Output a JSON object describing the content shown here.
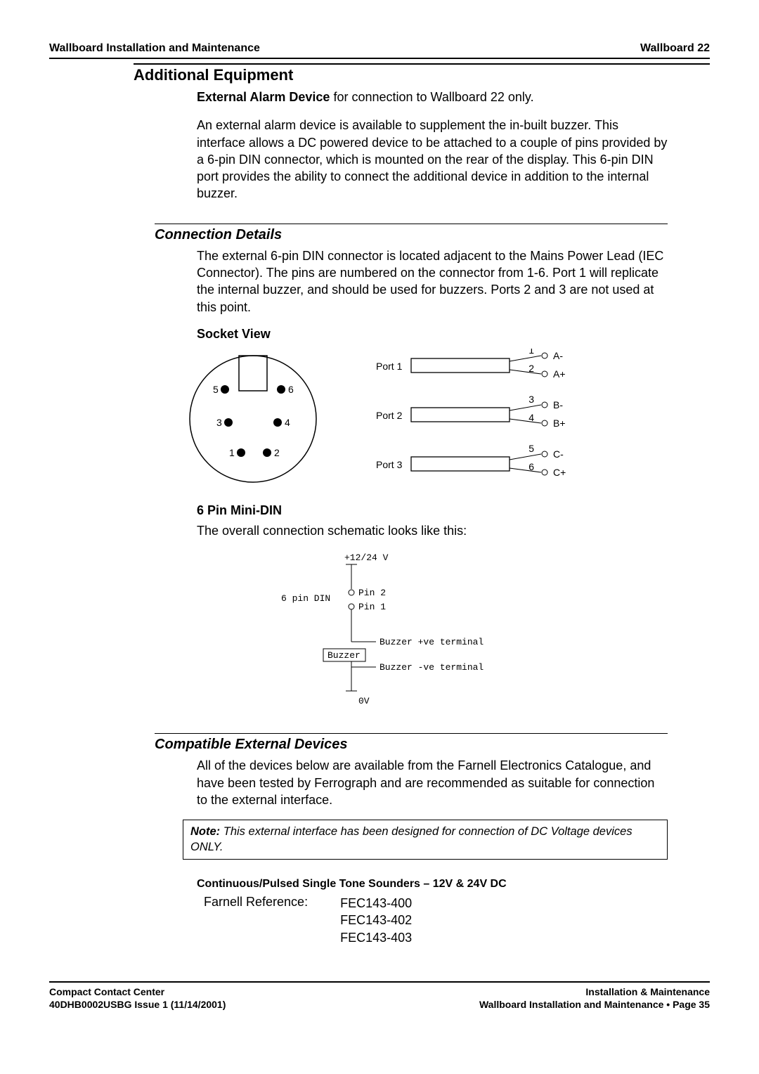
{
  "header": {
    "left": "Wallboard Installation and Maintenance",
    "right": "Wallboard 22"
  },
  "section1": {
    "heading": "Additional Equipment",
    "p1a": "External Alarm Device",
    "p1b": " for connection to Wallboard 22 only.",
    "p2": "An external alarm device is available to supplement the in-built buzzer. This interface allows a DC powered device to be attached to a couple of pins provided by a 6-pin DIN connector, which is mounted on the rear of the display.  This 6-pin DIN port provides the ability to connect the additional device in addition to the internal buzzer."
  },
  "connection": {
    "heading": "Connection Details",
    "p1": "The external 6-pin DIN connector is located adjacent to the Mains Power Lead (IEC Connector).  The pins are numbered on the connector from 1-6. Port 1 will replicate the internal buzzer, and should be used for buzzers. Ports 2 and 3 are not used at this point.",
    "socket_label": "Socket View",
    "socket_pins": [
      "5",
      "6",
      "3",
      "4",
      "1",
      "2"
    ],
    "ports": [
      {
        "name": "Port 1",
        "top_num": "1",
        "top_sig": "A-",
        "bot_num": "2",
        "bot_sig": "A+"
      },
      {
        "name": "Port 2",
        "top_num": "3",
        "top_sig": "B-",
        "bot_num": "4",
        "bot_sig": "B+"
      },
      {
        "name": "Port 3",
        "top_num": "5",
        "top_sig": "C-",
        "bot_num": "6",
        "bot_sig": "C+"
      }
    ],
    "minidin_label": "6 Pin Mini-DIN",
    "schematic_intro": "The overall connection schematic looks like this:",
    "schematic": {
      "vtop": "+12/24 V",
      "din": "6 pin DIN",
      "pin2": "Pin 2",
      "pin1": "Pin 1",
      "buzzer": "Buzzer",
      "pos": "Buzzer +ve terminal",
      "neg": "Buzzer -ve terminal",
      "vbot": "0V"
    }
  },
  "compat": {
    "heading": "Compatible External Devices",
    "p1": "All of the devices below are available from the Farnell Electronics Catalogue, and have been tested by Ferrograph and are recommended as suitable for connection to the external interface.",
    "note_label": "Note:",
    "note_text": " This external interface has been designed for connection of DC Voltage devices ONLY.",
    "sounders_heading": "Continuous/Pulsed Single Tone Sounders – 12V & 24V DC",
    "ref_label": "Farnell Reference:",
    "refs": [
      "FEC143-400",
      "FEC143-402",
      "FEC143-403"
    ]
  },
  "footer": {
    "left1": "Compact Contact Center",
    "left2": "40DHB0002USBG Issue 1 (11/14/2001)",
    "right1": "Installation & Maintenance",
    "right2": "Wallboard Installation and Maintenance • Page 35"
  }
}
